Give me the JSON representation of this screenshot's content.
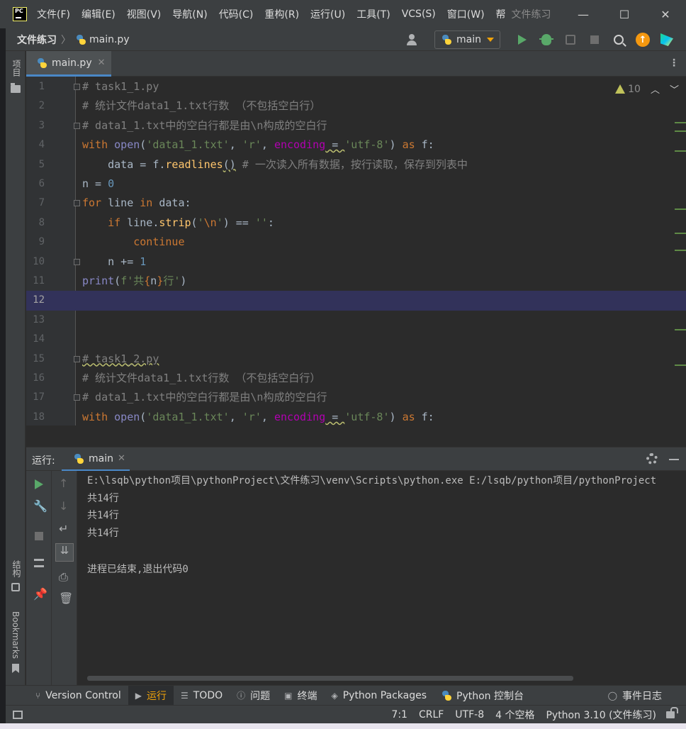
{
  "titlebar": {
    "menus": [
      "文件(F)",
      "编辑(E)",
      "视图(V)",
      "导航(N)",
      "代码(C)",
      "重构(R)",
      "运行(U)",
      "工具(T)",
      "VCS(S)",
      "窗口(W)",
      "帮"
    ],
    "title": "文件练习"
  },
  "navbar": {
    "project": "文件练习",
    "file": "main.py",
    "run_config": "main"
  },
  "left_stripe": {
    "project": "项目",
    "structure": "结构",
    "bookmarks": "Bookmarks"
  },
  "editor": {
    "tab_label": "main.py",
    "warnings_count": "10",
    "current_line": 12,
    "line_numbers": [
      "1",
      "2",
      "3",
      "4",
      "5",
      "6",
      "7",
      "8",
      "9",
      "10",
      "11",
      "12",
      "13",
      "14",
      "15",
      "16",
      "17",
      "18"
    ]
  },
  "run_window": {
    "title": "运行:",
    "tab_label": "main",
    "console_lines": [
      "E:\\lsqb\\python项目\\pythonProject\\文件练习\\venv\\Scripts\\python.exe E:/lsqb/python项目/pythonProject",
      "共14行",
      "共14行",
      "共14行",
      "",
      "进程已结束,退出代码0"
    ]
  },
  "bottom_bar": {
    "tabs": [
      "Version Control",
      "运行",
      "TODO",
      "问题",
      "终端",
      "Python Packages",
      "Python 控制台"
    ],
    "event_log": "事件日志"
  },
  "status_bar": {
    "position": "7:1",
    "line_sep": "CRLF",
    "encoding": "UTF-8",
    "indent": "4 个空格",
    "interpreter": "Python 3.10 (文件练习)"
  },
  "colors": {
    "accent": "#4a88c7",
    "run_green": "#59a869",
    "keyword": "#cc7832",
    "string": "#6a8759",
    "number": "#6897bb",
    "comment": "#808080"
  }
}
